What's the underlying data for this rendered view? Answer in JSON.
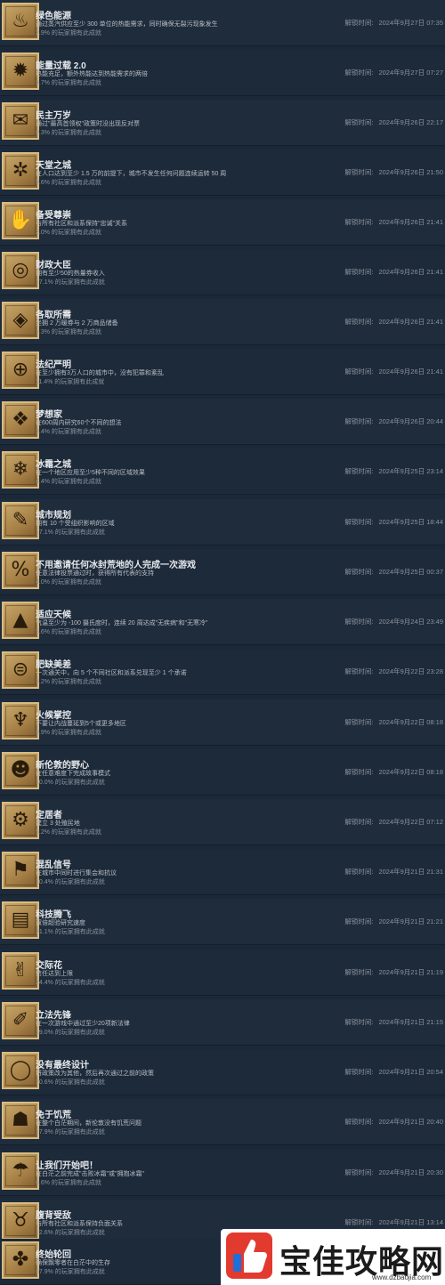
{
  "unlock_prefix": "解锁时间:",
  "achievements": [
    {
      "icon": "radiator-icon",
      "glyph": "♨",
      "title": "绿色能源",
      "desc": "通过蒸汽供应至少 300 单位的热能需求，同时确保无裂污现象发生",
      "pct": "2.9% 的玩家拥有此成就",
      "unlock": "2024年9月27日 07:35"
    },
    {
      "icon": "sun-icon",
      "glyph": "✹",
      "title": "能量过载 2.0",
      "desc": "热能充足，额外热能达到热能需求的两倍",
      "pct": "3.7% 的玩家拥有此成就",
      "unlock": "2024年9月27日 07:27"
    },
    {
      "icon": "ballot-box-icon",
      "glyph": "✉",
      "title": "民主万岁",
      "desc": "通过\"最高首领权\"政策时没出现反对票",
      "pct": "0.3% 的玩家拥有此成就",
      "unlock": "2024年9月26日 22:17"
    },
    {
      "icon": "palm-tree-icon",
      "glyph": "✲",
      "title": "天堂之城",
      "desc": "在人口达到至少 1.5 万的前提下，城市不发生任何问题连续运转 50 周",
      "pct": "9.6% 的玩家拥有此成就",
      "unlock": "2024年9月26日 21:50"
    },
    {
      "icon": "hand-icon",
      "glyph": "✋",
      "title": "备受尊崇",
      "desc": "与所有社区和派系保持\"忠诚\"关系",
      "pct": "2.0% 的玩家拥有此成就",
      "unlock": "2024年9月26日 21:41"
    },
    {
      "icon": "coins-icon",
      "glyph": "◎",
      "title": "财政大臣",
      "desc": "拥有至少50的热量券收入",
      "pct": "17.1% 的玩家拥有此成就",
      "unlock": "2024年9月26日 21:41"
    },
    {
      "icon": "diamond-icon",
      "glyph": "◈",
      "title": "各取所需",
      "desc": "坐拥 2 万暖券与 2 万商品储备",
      "pct": "1.3% 的玩家拥有此成就",
      "unlock": "2024年9月26日 21:41"
    },
    {
      "icon": "crosshair-icon",
      "glyph": "⊕",
      "title": "法纪严明",
      "desc": "在至少拥有3万人口的城市中，没有犯罪和紊乱",
      "pct": "11.4% 的玩家拥有此成就",
      "unlock": "2024年9月26日 21:41"
    },
    {
      "icon": "ornament-icon",
      "glyph": "❖",
      "title": "梦想家",
      "desc": "在600周内研究60个不同的想法",
      "pct": "3.4% 的玩家拥有此成就",
      "unlock": "2024年9月26日 20:44"
    },
    {
      "icon": "frost-hand-icon",
      "glyph": "❄",
      "title": "冰霜之城",
      "desc": "在一个地区应用至少5种不同的区域效果",
      "pct": "4.4% 的玩家拥有此成就",
      "unlock": "2024年9月25日 23:14"
    },
    {
      "icon": "blueprint-hand-icon",
      "glyph": "✎",
      "title": "城市规划",
      "desc": "拥有 10 个受组织影响的区域",
      "pct": "17.1% 的玩家拥有此成就",
      "unlock": "2024年9月25日 18:44"
    },
    {
      "icon": "hundred-percent-icon",
      "glyph": "%",
      "title": "不用邀请任何冰封荒地的人完成一次游戏",
      "desc": "任意法律投票通过时，获得所有代表的支持",
      "pct": "4.0% 的玩家拥有此成就",
      "unlock": "2024年9月25日 00:37"
    },
    {
      "icon": "mountain-icon",
      "glyph": "▲",
      "title": "适应天候",
      "desc": "气温至少为 -100 摄氏度时，连续 20 周达成\"无疾病\"和\"无寒冷\"",
      "pct": "5.6% 的玩家拥有此成就",
      "unlock": "2024年9月24日 23:49"
    },
    {
      "icon": "barrel-icon",
      "glyph": "⊜",
      "title": "肥缺美差",
      "desc": "一次通关中，向 5 个不同社区和派系兑现至少 1 个承诺",
      "pct": "3.2% 的玩家拥有此成就",
      "unlock": "2024年9月22日 23:28"
    },
    {
      "icon": "fire-icon",
      "glyph": "♆",
      "title": "火候掌控",
      "desc": "不要让内战蔓延到5个或更多地区",
      "pct": "8.9% 的玩家拥有此成就",
      "unlock": "2024年9月22日 08:18"
    },
    {
      "icon": "mask-icon",
      "glyph": "☻",
      "title": "新伦敦的野心",
      "desc": "在任意难度下完成故事模式",
      "pct": "10.0% 的玩家拥有此成就",
      "unlock": "2024年9月22日 08:18"
    },
    {
      "icon": "gear-crown-icon",
      "glyph": "⚙",
      "title": "定居者",
      "desc": "建立 3 处殖民地",
      "pct": "5.2% 的玩家拥有此成就",
      "unlock": "2024年9月22日 07:12"
    },
    {
      "icon": "signal-flag-icon",
      "glyph": "⚑",
      "title": "混乱信号",
      "desc": "在城市中同时进行集会和抗议",
      "pct": "10.4% 的玩家拥有此成就",
      "unlock": "2024年9月21日 21:31"
    },
    {
      "icon": "book-icon",
      "glyph": "▤",
      "title": "科技腾飞",
      "desc": "双倍超验研究速度",
      "pct": "21.1% 的玩家拥有此成就",
      "unlock": "2024年9月21日 21:21"
    },
    {
      "icon": "handshake-icon",
      "glyph": "✌",
      "title": "交际花",
      "desc": "信任达到上限",
      "pct": "24.4% 的玩家拥有此成就",
      "unlock": "2024年9月21日 21:19"
    },
    {
      "icon": "scroll-icon",
      "glyph": "✐",
      "title": "立法先锋",
      "desc": "在一次游戏中通过至少20项新法律",
      "pct": "19.0% 的玩家拥有此成就",
      "unlock": "2024年9月21日 21:15"
    },
    {
      "icon": "ring-icon",
      "glyph": "◯",
      "title": "没有最终设计",
      "desc": "将政策改为其他，然后再次通过之前的政策",
      "pct": "20.6% 的玩家拥有此成就",
      "unlock": "2024年9月21日 20:54"
    },
    {
      "icon": "roast-icon",
      "glyph": "☗",
      "title": "免于饥荒",
      "desc": "在整个白茫期间，新伦敦没有饥荒问题",
      "pct": "17.9% 的玩家拥有此成就",
      "unlock": "2024年9月21日 20:40"
    },
    {
      "icon": "umbrella-icon",
      "glyph": "☂",
      "title": "让我们开始吧！",
      "desc": "在白茫之前完成\"击败冰霜\"或\"拥抱冰霜\"",
      "pct": "6.6% 的玩家拥有此成就",
      "unlock": "2024年9月21日 20:30"
    },
    {
      "icon": "rat-icon",
      "glyph": "♉",
      "title": "腹背受敌",
      "desc": "与所有社区和派系保持负面关系",
      "pct": "12.6% 的玩家拥有此成就",
      "unlock": "2024年9月21日 13:14"
    },
    {
      "icon": "cycle-icon",
      "glyph": "✤",
      "title": "终始轮回",
      "desc": "确保飘零者在白茫中的生存",
      "pct": "67.9% 的玩家拥有此成就",
      "unlock": ""
    }
  ],
  "watermark": {
    "name": "宝佳攻略网",
    "url": "www.dzbaojia.com"
  },
  "colors": {
    "bg": "#1b2838",
    "icon_gold": "#c9a86a"
  }
}
